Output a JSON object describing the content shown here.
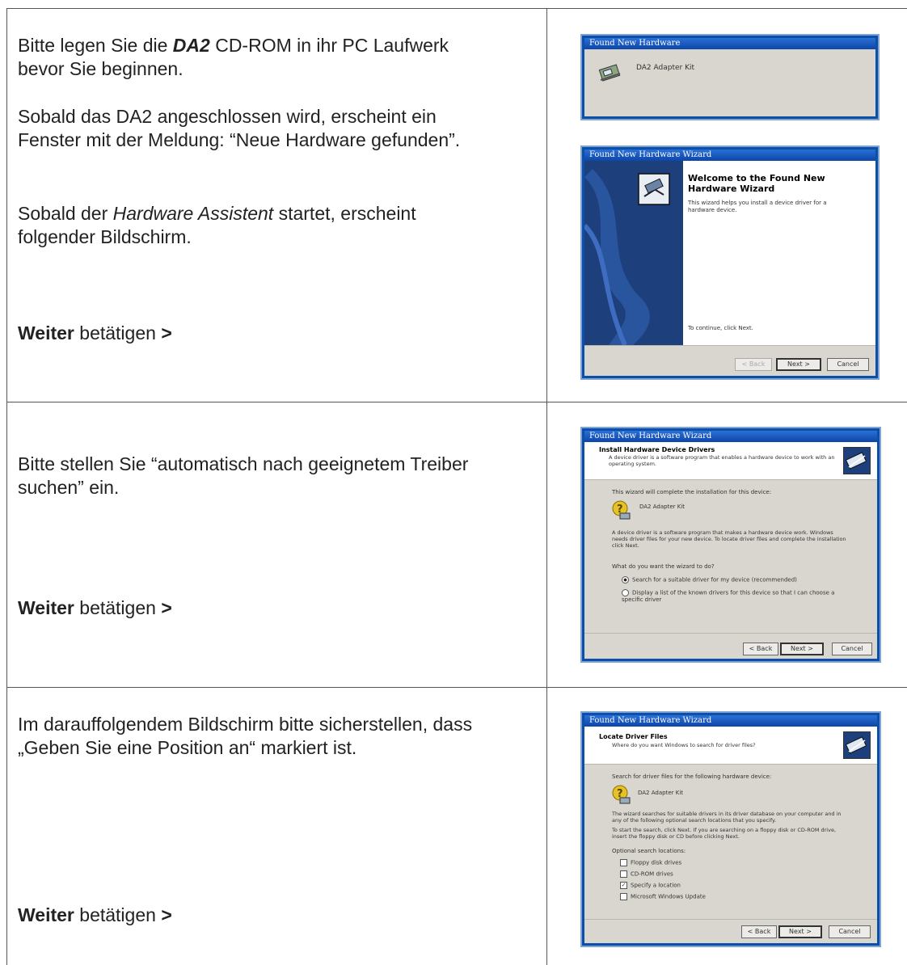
{
  "rows": [
    {
      "paragraphs": {
        "p1_prefix": "Bitte legen Sie die ",
        "p1_bold": "DA2",
        "p1_rest": " CD-ROM in ihr PC Laufwerk",
        "p1_line2": "bevor Sie beginnen.",
        "p2_line1": "Sobald das DA2 angeschlossen wird, erscheint ein",
        "p2_line2": "Fenster mit der Meldung: “Neue Hardware gefunden”.",
        "p3_prefix": "Sobald der ",
        "p3_italic": "Hardware Assistent",
        "p3_rest": " startet, erscheint",
        "p3_line2": "folgender Bildschirm."
      },
      "action": {
        "bold": "Weiter",
        "rest": " betätigen ",
        "arrow": ">"
      },
      "balloon": {
        "title": "Found New Hardware",
        "device": "DA2 Adapter Kit"
      },
      "welcome": {
        "title": "Found New Hardware Wizard",
        "heading": "Welcome to the Found New Hardware Wizard",
        "desc": "This wizard helps you install a device driver for a hardware device.",
        "continue": "To continue, click Next.",
        "back": "< Back",
        "next": "Next >",
        "cancel": "Cancel"
      }
    },
    {
      "paragraphs": {
        "line1": "Bitte stellen Sie “automatisch nach geeignetem Treiber",
        "line2": "suchen” ein."
      },
      "action": {
        "bold": "Weiter",
        "rest": " betätigen ",
        "arrow": ">"
      },
      "install": {
        "title": "Found New Hardware Wizard",
        "header": "Install Hardware Device Drivers",
        "subheader": "A device driver is a software program that enables a hardware device to work with an operating system.",
        "complete": "This wizard will complete the installation for this device:",
        "device": "DA2 Adapter Kit",
        "info": "A device driver is a software program that makes a hardware device work. Windows needs driver files for your new device. To locate driver files and complete the installation click Next.",
        "question": "What do you want the wizard to do?",
        "option1": "Search for a suitable driver for my device (recommended)",
        "option2": "Display a list of the known drivers for this device so that I can choose a specific driver",
        "back": "< Back",
        "next": "Next >",
        "cancel": "Cancel"
      }
    },
    {
      "paragraphs": {
        "line1": "Im darauffolgendem Bildschirm bitte sicherstellen, dass",
        "line2": "„Geben Sie eine Position an“ markiert ist."
      },
      "action": {
        "bold": "Weiter",
        "rest": " betätigen ",
        "arrow": ">"
      },
      "locate": {
        "title": "Found New Hardware Wizard",
        "header": "Locate Driver Files",
        "subheader": "Where do you want Windows to search for driver files?",
        "search_for": "Search for driver files for the following hardware device:",
        "device": "DA2 Adapter Kit",
        "info1": "The wizard searches for suitable drivers in its driver database on your computer and in any of the following optional search locations that you specify.",
        "info2": "To start the search, click Next. If you are searching on a floppy disk or CD-ROM drive, insert the floppy disk or CD before clicking Next.",
        "optional": "Optional search locations:",
        "opt_floppy": "Floppy disk drives",
        "opt_cdrom": "CD-ROM drives",
        "opt_specify": "Specify a location",
        "opt_update": "Microsoft Windows Update",
        "back": "< Back",
        "next": "Next >",
        "cancel": "Cancel"
      }
    }
  ]
}
